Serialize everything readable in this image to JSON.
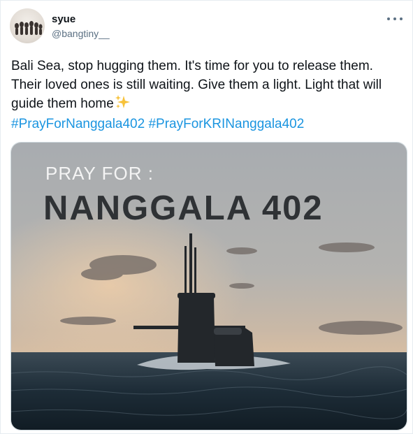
{
  "user": {
    "name": "syue",
    "handle": "@bangtiny__"
  },
  "tweet": {
    "text": "Bali Sea, stop hugging them. It's time for you to release them. Their loved ones is still waiting. Give them a light. Light that will guide them home",
    "hashtags": [
      "#PrayForNanggala402",
      "#PrayForKRINanggala402"
    ]
  },
  "image": {
    "subtitle": "PRAY FOR :",
    "title": "NANGGALA 402"
  },
  "icons": {
    "more": "more-options-icon",
    "sparkles": "sparkles-emoji-icon",
    "avatar": "user-avatar"
  },
  "colors": {
    "hashtag": "#1b95e0",
    "handle": "#5b7083",
    "text": "#0f1419"
  }
}
